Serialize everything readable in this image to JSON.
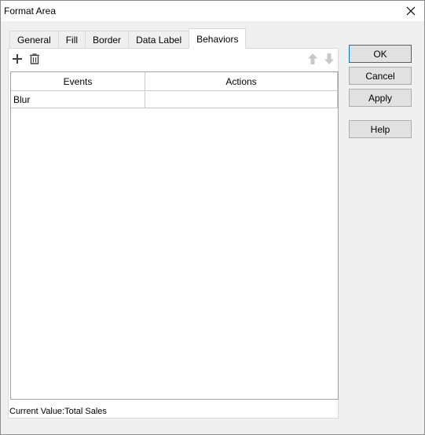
{
  "window": {
    "title": "Format Area"
  },
  "tabs": [
    {
      "label": "General",
      "active": false
    },
    {
      "label": "Fill",
      "active": false
    },
    {
      "label": "Border",
      "active": false
    },
    {
      "label": "Data Label",
      "active": false
    },
    {
      "label": "Behaviors",
      "active": true
    }
  ],
  "toolbar": {
    "add_icon": "plus-icon",
    "delete_icon": "trash-icon",
    "move_up_icon": "arrow-up-icon",
    "move_down_icon": "arrow-down-icon"
  },
  "grid": {
    "columns": [
      "Events",
      "Actions"
    ],
    "rows": [
      {
        "event": "Blur",
        "action": ""
      }
    ]
  },
  "status": {
    "current_value": "Current Value:Total Sales"
  },
  "buttons": {
    "ok": "OK",
    "cancel": "Cancel",
    "apply": "Apply",
    "help": "Help"
  },
  "colors": {
    "accent": "#0078d7",
    "dialog_bg": "#f0f0f0",
    "disabled_arrow": "#c8c8c8"
  }
}
